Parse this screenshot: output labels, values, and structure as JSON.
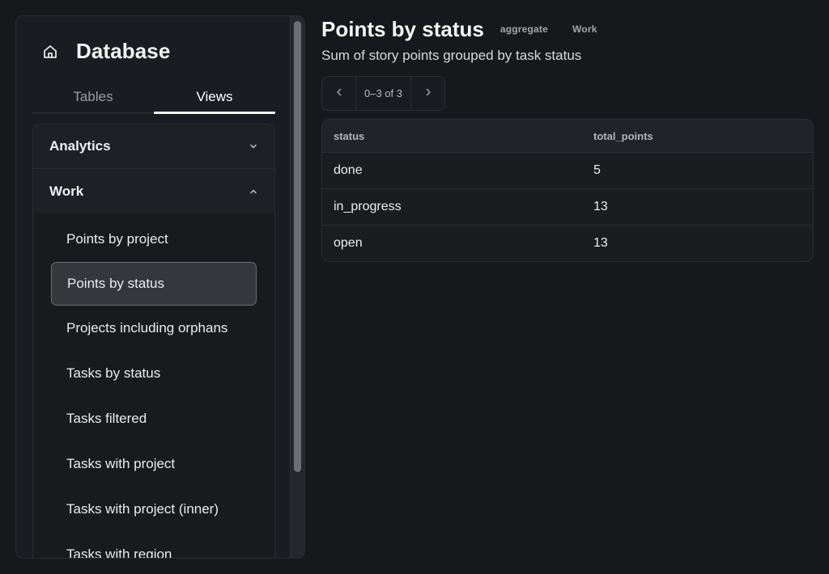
{
  "sidebar": {
    "title": "Database",
    "tabs": [
      {
        "label": "Tables",
        "active": false
      },
      {
        "label": "Views",
        "active": true
      }
    ],
    "groups": [
      {
        "label": "Analytics",
        "expanded": false
      },
      {
        "label": "Work",
        "expanded": true
      }
    ],
    "items": [
      {
        "label": "Points by project",
        "selected": false
      },
      {
        "label": "Points by status",
        "selected": true
      },
      {
        "label": "Projects including orphans",
        "selected": false
      },
      {
        "label": "Tasks by status",
        "selected": false
      },
      {
        "label": "Tasks filtered",
        "selected": false
      },
      {
        "label": "Tasks with project",
        "selected": false
      },
      {
        "label": "Tasks with project (inner)",
        "selected": false
      },
      {
        "label": "Tasks with region",
        "selected": false
      }
    ]
  },
  "header": {
    "title": "Points by status",
    "badges": [
      "aggregate",
      "Work"
    ],
    "subtitle": "Sum of story points grouped by task status"
  },
  "pager": {
    "label": "0–3 of 3"
  },
  "table": {
    "columns": [
      "status",
      "total_points"
    ],
    "rows": [
      [
        "done",
        "5"
      ],
      [
        "in_progress",
        "13"
      ],
      [
        "open",
        "13"
      ]
    ]
  },
  "icons": {
    "home": "home-icon",
    "collapsed": "chevron-down-icon",
    "expanded": "chevron-up-icon",
    "prev": "chevron-left-icon",
    "next": "chevron-right-icon"
  }
}
